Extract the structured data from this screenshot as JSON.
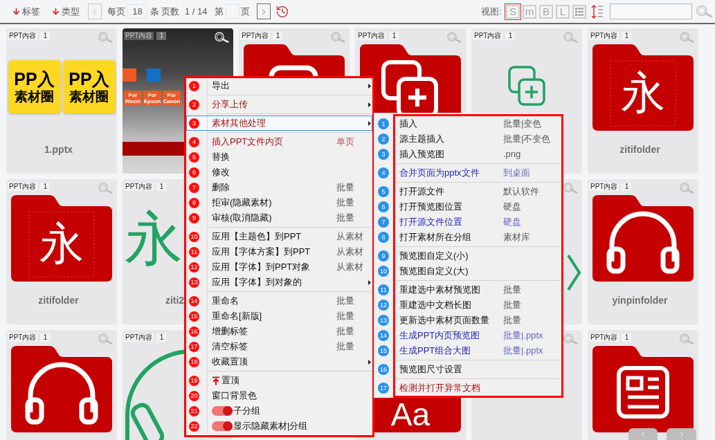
{
  "toolbar": {
    "filters": [
      {
        "label": "标签"
      },
      {
        "label": "类型"
      }
    ],
    "prev_button": {
      "disabled": true
    },
    "per_page_label": "每页",
    "per_page": "18",
    "per_page_unit": "条",
    "pages_label": "页数",
    "pages": "1 / 14",
    "goto_label": "第",
    "goto_unit": "页",
    "next_button": {
      "disabled": false
    },
    "view_label": "视图:",
    "views": [
      {
        "kind": "letter",
        "label": "S",
        "selected": true
      },
      {
        "kind": "letter",
        "label": "m",
        "selected": false
      },
      {
        "kind": "letter",
        "label": "B",
        "selected": false
      },
      {
        "kind": "letter",
        "label": "L",
        "selected": false
      },
      {
        "kind": "list",
        "selected": false
      }
    ]
  },
  "grid": {
    "rows": [
      [
        {
          "kind": "logo",
          "tag": "PPT内容",
          "count": "1",
          "magnifier": true,
          "tiles": [
            {
              "top": "PP入",
              "bottom": "素材圈"
            },
            {
              "top": "PP入",
              "bottom": "素材圈"
            }
          ],
          "label": "1.pptx"
        },
        {
          "kind": "slide",
          "tag": "PPT内容",
          "count": "1",
          "magnifier": true,
          "tiles": [
            {
              "text": "For Ricoh"
            },
            {
              "text": "For Epson"
            },
            {
              "text": "For Canon"
            }
          ]
        },
        {
          "kind": "folder",
          "emblem": {
            "kind": "frame"
          },
          "tag": "PPT内容",
          "count": "1",
          "magnifier": true
        },
        {
          "kind": "folder",
          "emblem": {
            "kind": "copies"
          },
          "tag": "PPT内容",
          "count": "1",
          "magnifier": true
        },
        {
          "kind": "outline",
          "emblem": {
            "kind": "copies"
          },
          "tag": "PPT内容",
          "count": "1",
          "magnifier": true
        },
        {
          "kind": "folder",
          "emblem": {
            "kind": "glyph",
            "text": "永"
          },
          "tag": "PPT内容",
          "count": "1",
          "magnifier": true,
          "label": "zitifolder"
        }
      ],
      [
        {
          "kind": "folder",
          "emblem": {
            "kind": "glyph",
            "text": "永"
          },
          "tag": "PPT内容",
          "count": "1",
          "magnifier": true,
          "label": "zitifolder"
        },
        {
          "kind": "big_glyph",
          "glyph": "永",
          "tag": "PPT内容",
          "count": "1",
          "magnifier": false,
          "label": "ziti2"
        },
        null,
        null,
        {
          "kind": "outline",
          "emblem": {
            "kind": "chevron"
          },
          "magnifier": true
        },
        {
          "kind": "folder",
          "emblem": {
            "kind": "headphones"
          },
          "tag": "PPT内容",
          "count": "1",
          "magnifier": true,
          "label": "yinpinfolder"
        }
      ],
      [
        {
          "kind": "folder",
          "emblem": {
            "kind": "headphones"
          },
          "tag": "PPT内容",
          "count": "1",
          "magnifier": true
        },
        {
          "kind": "outline",
          "emblem": {
            "kind": "headphones"
          },
          "tag": "PPT内容",
          "count": "1",
          "magnifier": false
        },
        null,
        {
          "kind": "folder",
          "emblem": {
            "kind": "sample",
            "text": "Aa"
          },
          "magnifier": false
        },
        {
          "kind": "outline",
          "magnifier": true
        },
        {
          "kind": "folder",
          "emblem": {
            "kind": "document"
          },
          "tag": "PPT内容",
          "count": "1",
          "magnifier": true
        }
      ]
    ]
  },
  "context_menu": {
    "groups": [
      [
        {
          "num": "1",
          "text": "导出",
          "kind": "plain",
          "submenu": true,
          "selected": false
        }
      ],
      [
        {
          "num": "2",
          "text": "分享上传",
          "color": "#a31515",
          "kind": "plain",
          "submenu": true,
          "selected": false
        }
      ],
      [
        {
          "num": "3",
          "text": "素材其他处理",
          "color": "#a31515",
          "kind": "plain",
          "submenu": true,
          "selected": true
        }
      ],
      [
        {
          "num": "4",
          "text": "插入PPT文件内页",
          "hint": "单页",
          "color": "#a31515",
          "kind": "plain",
          "submenu": false,
          "selected": false
        },
        {
          "num": "5",
          "text": "替换",
          "kind": "plain",
          "submenu": false,
          "selected": false
        },
        {
          "num": "6",
          "text": "修改",
          "kind": "plain",
          "submenu": false,
          "selected": false
        },
        {
          "num": "7",
          "text": "删除",
          "hint": "批量",
          "kind": "plain",
          "submenu": false,
          "selected": false
        },
        {
          "num": "8",
          "text": "拒审(隐藏素材)",
          "hint": "批量",
          "kind": "plain",
          "submenu": false,
          "selected": false
        },
        {
          "num": "9",
          "text": "审核(取消隐藏)",
          "hint": "批量",
          "kind": "plain",
          "submenu": false,
          "selected": false
        }
      ],
      [
        {
          "num": "10",
          "text": "应用【主题色】到PPT",
          "hint": "从素材",
          "kind": "plain",
          "submenu": false,
          "selected": false
        },
        {
          "num": "11",
          "text": "应用【字体方案】到PPT",
          "hint": "从素材",
          "kind": "plain",
          "submenu": false,
          "selected": false
        },
        {
          "num": "12",
          "text": "应用【字体】到PPT对象",
          "hint": "从素材",
          "kind": "plain",
          "submenu": false,
          "selected": false
        },
        {
          "num": "13",
          "text": "应用【字体】到对象的",
          "kind": "plain",
          "submenu": true,
          "selected": false
        }
      ],
      [
        {
          "num": "14",
          "text": "重命名",
          "hint": "批量",
          "kind": "plain",
          "submenu": false,
          "selected": false
        },
        {
          "num": "15",
          "text": "重命名[新版]",
          "hint": "批量",
          "kind": "plain",
          "submenu": false,
          "selected": false
        },
        {
          "num": "16",
          "text": "增删标签",
          "hint": "批量",
          "kind": "plain",
          "submenu": false,
          "selected": false
        },
        {
          "num": "17",
          "text": "清空标签",
          "hint": "批量",
          "kind": "plain",
          "submenu": false,
          "selected": false
        },
        {
          "num": "18",
          "text": "收藏置顶",
          "kind": "plain",
          "submenu": true,
          "selected": false
        }
      ],
      [
        {
          "num": "19",
          "text": "置顶",
          "kind": "pin",
          "submenu": false,
          "selected": false
        },
        {
          "num": "20",
          "text": "窗口背景色",
          "kind": "plain",
          "submenu": false,
          "selected": false
        },
        {
          "num": "21",
          "text": "子分组",
          "kind": "toggle",
          "on": true,
          "submenu": false,
          "selected": false
        },
        {
          "num": "22",
          "text": "显示隐藏素材|分组",
          "kind": "toggle",
          "on": true,
          "submenu": false,
          "selected": false
        }
      ]
    ]
  },
  "submenu": {
    "groups": [
      [
        {
          "num": "1",
          "text": "插入",
          "hint": "批量|变色"
        },
        {
          "num": "2",
          "text": "源主题插入",
          "hint": "批量|不变色"
        },
        {
          "num": "3",
          "text": "插入预览图",
          "hint": ".png"
        }
      ],
      [
        {
          "num": "4",
          "text": "合并页面为pptx文件",
          "hint": "到桌面",
          "color": "#2626b0"
        }
      ],
      [
        {
          "num": "5",
          "text": "打开源文件",
          "hint": "默认软件"
        },
        {
          "num": "6",
          "text": "打开预览图位置",
          "hint": "硬盘"
        },
        {
          "num": "7",
          "text": "打开源文件位置",
          "hint": "硬盘",
          "color": "#2626b0"
        },
        {
          "num": "8",
          "text": "打开素材所在分组",
          "hint": "素材库"
        }
      ],
      [
        {
          "num": "9",
          "text": "预览图自定义(小)"
        },
        {
          "num": "10",
          "text": "预览图自定义(大)"
        }
      ],
      [
        {
          "num": "11",
          "text": "重建选中素材预览图",
          "hint": "批量"
        },
        {
          "num": "12",
          "text": "重建选中文档长图",
          "hint": "批量"
        },
        {
          "num": "13",
          "text": "更新选中素材页面数量",
          "hint": "批量"
        },
        {
          "num": "14",
          "text": "生成PPT内页预览图",
          "hint": "批量|.pptx",
          "color": "#2626b0"
        },
        {
          "num": "15",
          "text": "生成PPT组合大图",
          "hint": "批量|.pptx",
          "color": "#2626b0"
        }
      ],
      [
        {
          "num": "16",
          "text": "预览图尺寸设置"
        }
      ],
      [
        {
          "num": "17",
          "text": "检测并打开异常文档",
          "color": "#a31515"
        }
      ]
    ]
  }
}
